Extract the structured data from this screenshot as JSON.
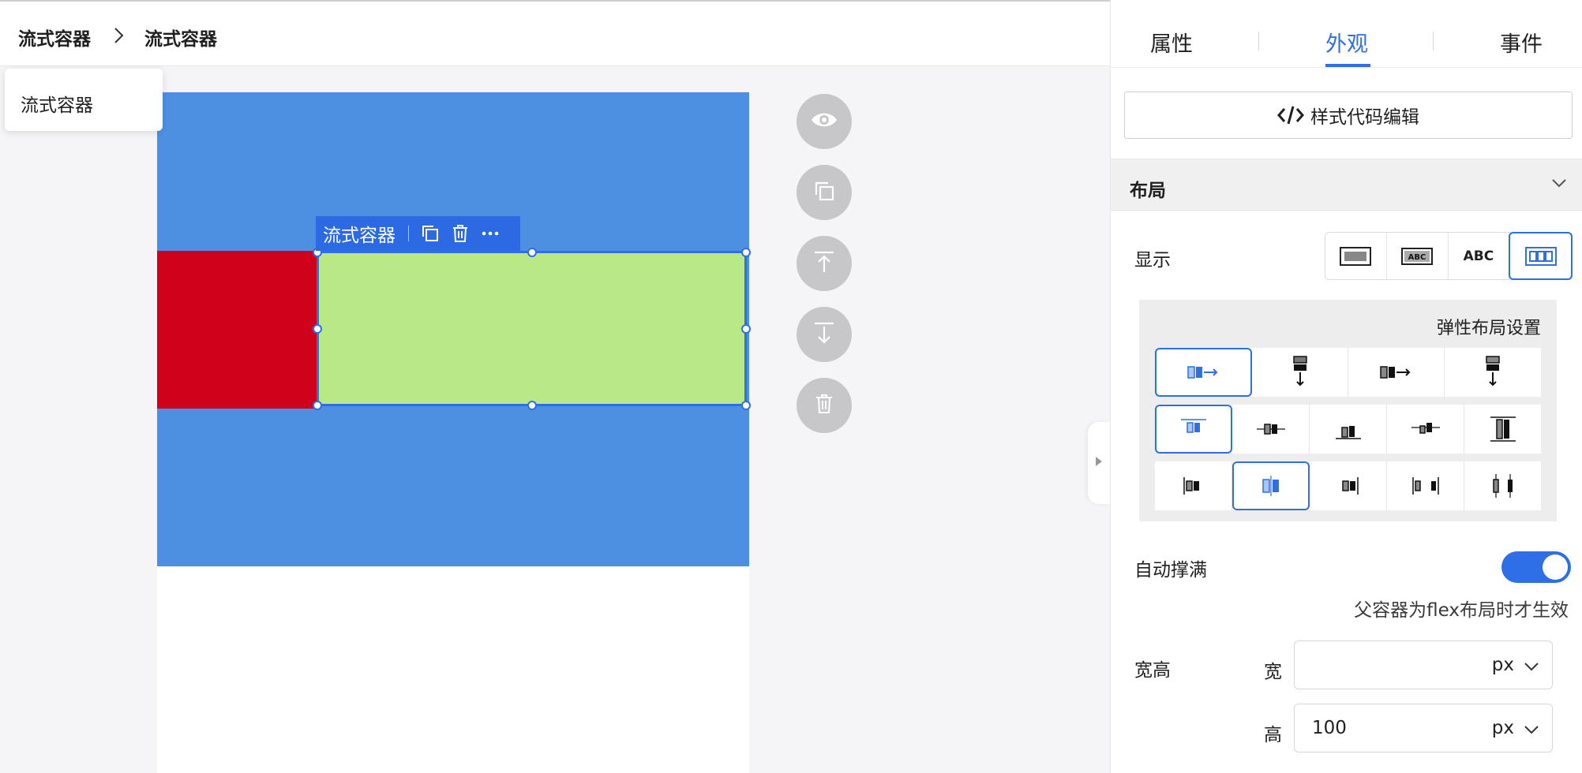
{
  "breadcrumb": {
    "items": [
      "流式容器",
      "流式容器"
    ]
  },
  "popup": {
    "label": "流式容器"
  },
  "selection_toolbar": {
    "label": "流式容器"
  },
  "canvas": {
    "colors": {
      "blue_container": "#4d90e2",
      "red_block": "#d0021b",
      "green_block": "#b8e986",
      "selection": "#2e6ee6"
    }
  },
  "floating_actions": [
    "eye-icon",
    "copy-icon",
    "move-up-icon",
    "move-down-icon",
    "delete-icon"
  ],
  "panel": {
    "tabs": [
      "属性",
      "外观",
      "事件"
    ],
    "active_tab": "外观",
    "code_button_label": "样式代码编辑",
    "layout_section": {
      "title": "布局",
      "display_label": "显示",
      "display_options": [
        "block",
        "inline-block",
        "ABC",
        "flex"
      ],
      "display_selected": "flex",
      "flex_settings_title": "弹性布局设置",
      "auto_fill_label": "自动撑满",
      "auto_fill_on": true,
      "auto_fill_hint": "父容器为flex布局时才生效",
      "size_label": "宽高",
      "width_label": "宽",
      "width_value": "",
      "width_unit": "px",
      "height_label": "高",
      "height_value": "100",
      "height_unit": "px"
    },
    "accent_color": "#2e6ee6"
  }
}
